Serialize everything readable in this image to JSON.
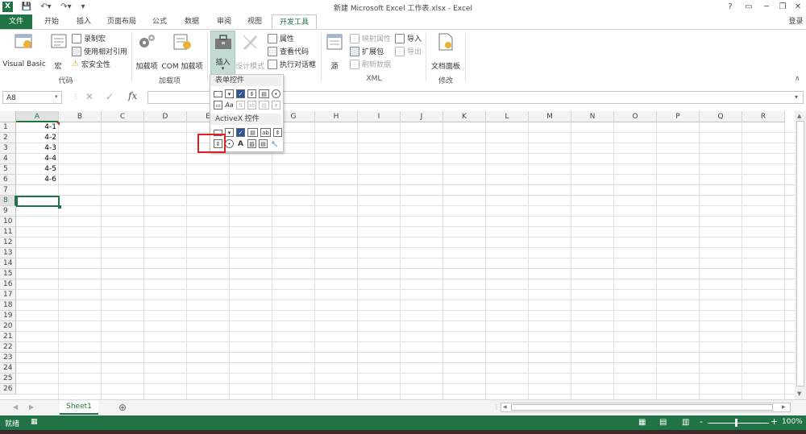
{
  "window": {
    "title": "新建 Microsoft Excel 工作表.xlsx - Excel",
    "login": "登录",
    "help": "?",
    "minimize": "─",
    "restore": "❐",
    "close": "✕"
  },
  "tabs": [
    "文件",
    "开始",
    "插入",
    "页面布局",
    "公式",
    "数据",
    "审阅",
    "视图",
    "开发工具"
  ],
  "ribbon": {
    "code_group": {
      "label": "代码",
      "visual_basic": "Visual Basic",
      "macro": "宏",
      "record_macro": "录制宏",
      "relative_ref": "使用相对引用",
      "macro_security": "宏安全性"
    },
    "addins_group": {
      "label": "加载项",
      "addins": "加载项",
      "com_addins": "COM 加载项"
    },
    "controls_group": {
      "insert": "插入",
      "design_mode": "设计模式",
      "properties": "属性",
      "view_code": "查看代码",
      "run_dialog": "执行对话框"
    },
    "xml_group": {
      "label": "XML",
      "source": "源",
      "map_properties": "映射属性",
      "expansion_packs": "扩展包",
      "refresh_data": "刷新数据",
      "import": "导入",
      "export": "导出"
    },
    "modify_group": {
      "label": "修改",
      "doc_panel": "文档面板"
    }
  },
  "formula_bar": {
    "name_box": "A8",
    "fx": "fx",
    "cancel": "✕",
    "enter": "✓",
    "value": ""
  },
  "dropdown": {
    "form_controls": "表单控件",
    "activex_controls": "ActiveX 控件"
  },
  "grid": {
    "columns": [
      "A",
      "B",
      "C",
      "D",
      "E",
      "F",
      "G",
      "H",
      "I",
      "J",
      "K",
      "L",
      "M",
      "N",
      "O",
      "P",
      "Q",
      "R"
    ],
    "rows": [
      "1",
      "2",
      "3",
      "4",
      "5",
      "6",
      "7",
      "8",
      "9",
      "10",
      "11",
      "12",
      "13",
      "14",
      "15",
      "16",
      "17",
      "18",
      "19",
      "20",
      "21",
      "22",
      "23",
      "24",
      "25",
      "26"
    ],
    "colA_values": [
      "4-1",
      "4-2",
      "4-3",
      "4-4",
      "4-5",
      "4-6"
    ],
    "selected_cell": "A8"
  },
  "sheets": {
    "tabs": [
      "Sheet1"
    ],
    "add": "⊕"
  },
  "status": {
    "ready": "就绪",
    "zoom": "100%",
    "minus": "-",
    "plus": "+"
  },
  "colors": {
    "excel_green": "#217346",
    "highlight_red": "#e02020"
  }
}
